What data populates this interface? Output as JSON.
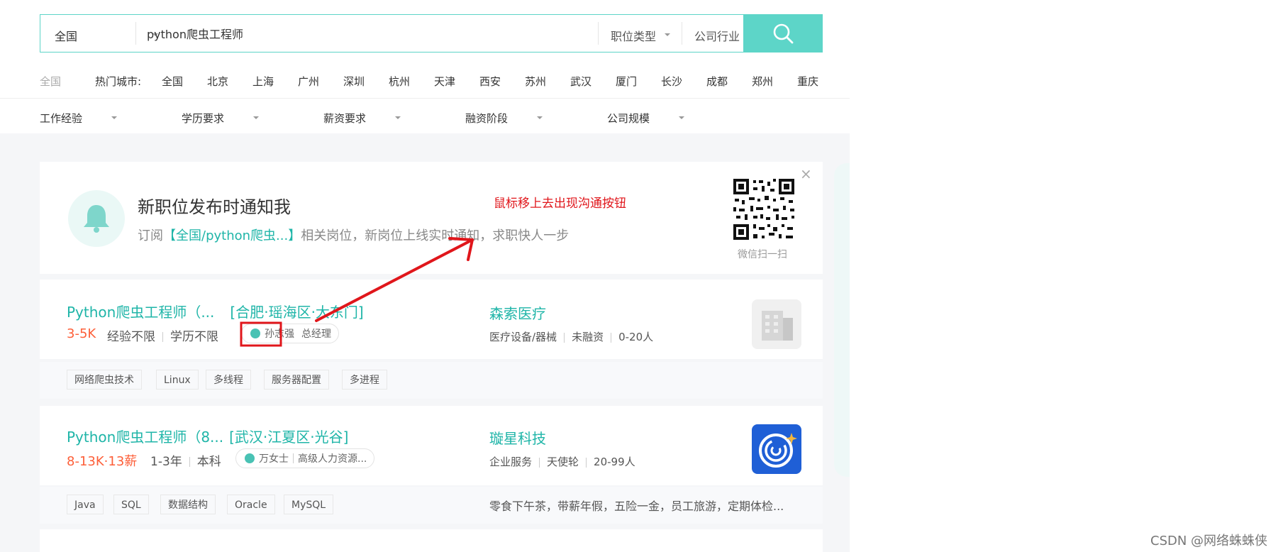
{
  "search": {
    "city": "全国",
    "query": "python爬虫工程师",
    "job_type": "职位类型",
    "industry": "公司行业"
  },
  "cities": {
    "current": "全国",
    "hot_label": "热门城市:",
    "list": [
      "全国",
      "北京",
      "上海",
      "广州",
      "深圳",
      "杭州",
      "天津",
      "西安",
      "苏州",
      "武汉",
      "厦门",
      "长沙",
      "成都",
      "郑州",
      "重庆"
    ]
  },
  "filters": [
    "工作经验",
    "学历要求",
    "薪资要求",
    "融资阶段",
    "公司规模"
  ],
  "notify": {
    "title": "新职位发布时通知我",
    "sub_prefix": "订阅",
    "sub_link": "【全国/python爬虫...】",
    "sub_suffix": "相关岗位，新岗位上线实时通知，求职快人一步",
    "qr_label": "微信扫一扫",
    "close": "×"
  },
  "annotation": {
    "note": "鼠标移上去出现沟通按钮"
  },
  "jobs": [
    {
      "title": "Python爬虫工程师（...",
      "location": "[合肥·瑶海区·大东门]",
      "salary": "3-5K",
      "experience": "经验不限",
      "education": "学历不限",
      "recruiter_name": "孙志强",
      "recruiter_title": "总经理",
      "company": "森索医疗",
      "company_industry": "医疗设备/器械",
      "company_funding": "未融资",
      "company_size": "0-20人",
      "tags": [
        "网络爬虫技术",
        "Linux",
        "多线程",
        "服务器配置",
        "多进程"
      ],
      "benefits": ""
    },
    {
      "title": "Python爬虫工程师（8...",
      "location": "[武汉·江夏区·光谷]",
      "salary": "8-13K·13薪",
      "experience": "1-3年",
      "education": "本科",
      "recruiter_name": "万女士",
      "recruiter_title": "高级人力资源...",
      "company": "璇星科技",
      "company_industry": "企业服务",
      "company_funding": "天使轮",
      "company_size": "20-99人",
      "tags": [
        "Java",
        "SQL",
        "数据结构",
        "Oracle",
        "MySQL"
      ],
      "benefits": "零食下午茶，带薪年假，五险一金，员工旅游，定期体检..."
    }
  ],
  "watermark": "CSDN @网络蛛蛛侠",
  "colors": {
    "accent": "#5dd5c8",
    "link": "#1fb5a8",
    "salary": "#fd5f39",
    "annotation": "#e0161b"
  }
}
